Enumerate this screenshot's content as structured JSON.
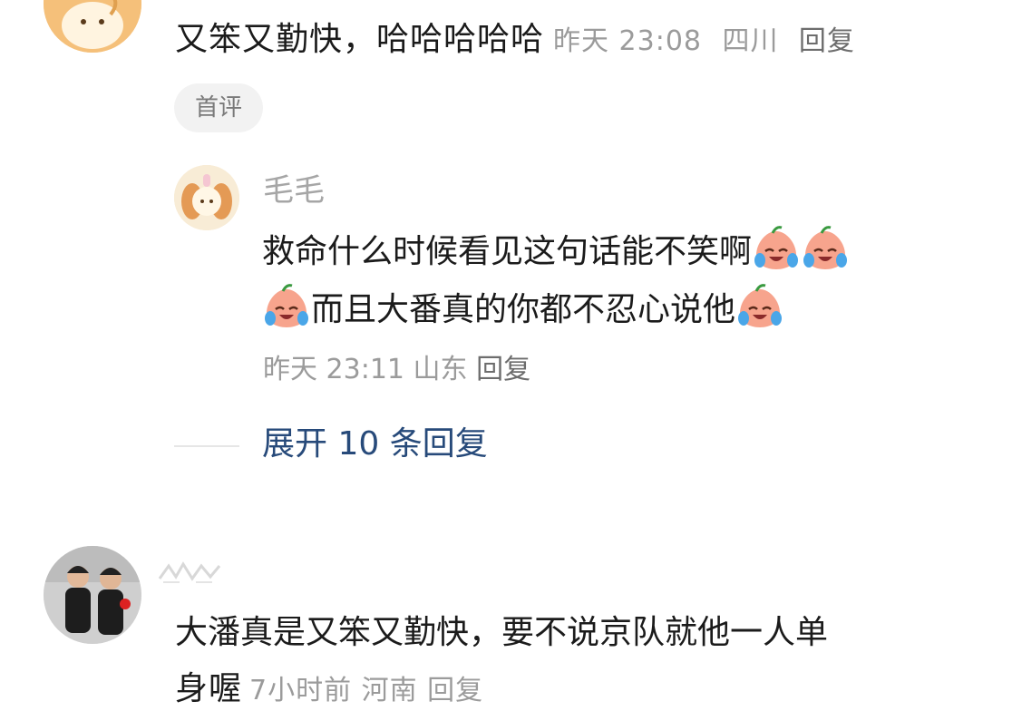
{
  "comment1": {
    "text": "又笨又勤快，哈哈哈哈哈",
    "time": "昨天 23:08",
    "location": "四川",
    "reply_label": "回复",
    "badge": "首评"
  },
  "reply1": {
    "username": "毛毛",
    "text_part1": "救命什么时候看见这句话能不笑啊",
    "text_part2": "而且大番真的你都不忍心说他",
    "emoji_name": "crying-laughing-emoji",
    "time": "昨天 23:11",
    "location": "山东",
    "reply_label": "回复"
  },
  "expand": {
    "label": "展开 10 条回复"
  },
  "comment2": {
    "text": "大潘真是又笨又勤快，要不说京队就他一人单",
    "text_tail": "身喔",
    "meta_partial": "7小时前 河南 回复"
  },
  "colors": {
    "link": "#274a7a",
    "meta": "#9b9b9b",
    "badge_bg": "#f2f2f2"
  }
}
